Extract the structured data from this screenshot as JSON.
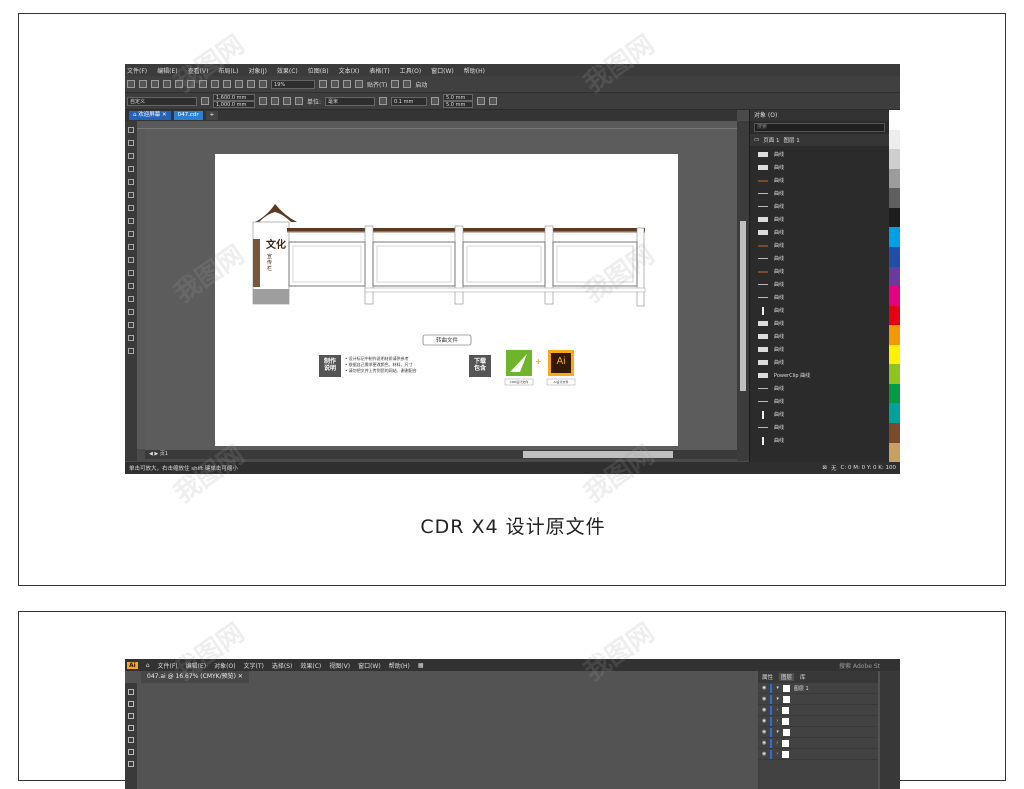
{
  "cdr": {
    "menu": [
      "文件(F)",
      "编辑(E)",
      "查看(V)",
      "布局(L)",
      "对象(J)",
      "效果(C)",
      "位图(B)",
      "文本(X)",
      "表格(T)",
      "工具(O)",
      "窗口(W)",
      "帮助(H)"
    ],
    "toolbar1": {
      "zoom": "19%",
      "snap": "贴齐(T)",
      "launch": "启动"
    },
    "toolbar2": {
      "preset": "自定义",
      "width": "1,600.0 mm",
      "height": "1,000.0 mm",
      "unit_label": "单位:",
      "unit": "毫米",
      "nudge": "0.1 mm",
      "dup_x": "5.0 mm",
      "dup_y": "5.0 mm"
    },
    "tabs": [
      "欢迎屏幕",
      "047.cdr"
    ],
    "page_tab": "页1",
    "status_left": "单击可放大，右击缩放住 shift 键单击可缩小",
    "status_fill": "无",
    "status_color": "C: 0 M: 0 Y: 0 K: 100",
    "docker": {
      "title": "对象 (O)",
      "search_placeholder": "搜索",
      "page": "页面 1",
      "layer": "图层 1",
      "items": [
        {
          "kind": "rect",
          "label": "曲线"
        },
        {
          "kind": "rect",
          "label": "曲线"
        },
        {
          "kind": "brown",
          "label": "曲线"
        },
        {
          "kind": "line",
          "label": "曲线"
        },
        {
          "kind": "line",
          "label": "曲线"
        },
        {
          "kind": "rect",
          "label": "曲线"
        },
        {
          "kind": "rect",
          "label": "曲线"
        },
        {
          "kind": "brown",
          "label": "曲线"
        },
        {
          "kind": "line",
          "label": "曲线"
        },
        {
          "kind": "brown",
          "label": "曲线"
        },
        {
          "kind": "line",
          "label": "曲线"
        },
        {
          "kind": "line",
          "label": "曲线"
        },
        {
          "kind": "vert",
          "label": "曲线"
        },
        {
          "kind": "rect",
          "label": "曲线"
        },
        {
          "kind": "rect",
          "label": "曲线"
        },
        {
          "kind": "rect",
          "label": "曲线"
        },
        {
          "kind": "rect",
          "label": "曲线"
        },
        {
          "kind": "rect",
          "label": "PowerClip 曲线"
        },
        {
          "kind": "line",
          "label": "曲线"
        },
        {
          "kind": "line",
          "label": "曲线"
        },
        {
          "kind": "vert",
          "label": "曲线"
        },
        {
          "kind": "line",
          "label": "曲线"
        },
        {
          "kind": "vert",
          "label": "曲线"
        }
      ]
    },
    "palette": [
      "#ffffff",
      "#ededed",
      "#cfcfcf",
      "#9c9c9c",
      "#5f5f5f",
      "#1e1e1e",
      "#00a0e9",
      "#1f4fa8",
      "#6a3a9e",
      "#e4007f",
      "#e60012",
      "#f39800",
      "#fff100",
      "#8fc31f",
      "#009944",
      "#00a29a",
      "#7b4a2a",
      "#c8a063"
    ]
  },
  "artwork": {
    "sign_title": "文化",
    "sign_sub": "宣传栏",
    "convert_label": "转曲文件",
    "notes_label_1": "制作",
    "notes_label_2": "说明",
    "notes": [
      "设计标记中制作说明材质请供参考",
      "根据自己需求更改颜色、材料、尺寸",
      "请勿把文件上传到您的网站、谢谢配合"
    ],
    "download_1": "下载",
    "download_2": "包含",
    "ai_icon": "Ai",
    "plus": "+",
    "cdr_caption": "CDR设计文件",
    "ai_caption": "AI设计文件"
  },
  "caption": "CDR X4 设计原文件",
  "ai": {
    "menu": [
      "文件(F)",
      "编辑(E)",
      "对象(O)",
      "文字(T)",
      "选择(S)",
      "效果(C)",
      "视图(V)",
      "窗口(W)",
      "帮助(H)"
    ],
    "doc_tab": "047.ai @ 16.67% (CMYK/预览)",
    "search_placeholder": "搜索 Adobe St",
    "panel_tabs": [
      "属性",
      "图层",
      "库"
    ],
    "layer_name": "图层 1"
  },
  "watermark": "我图网"
}
